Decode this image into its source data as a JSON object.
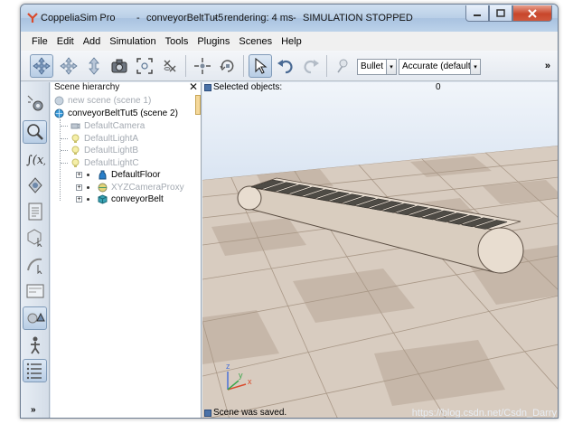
{
  "titlebar": {
    "app_name": "CoppeliaSim Pro",
    "separator": "-",
    "document": "conveyorBeltTut5",
    "rendering": "rendering: 4 ms",
    "state": "SIMULATION STOPPED"
  },
  "menubar": {
    "items": [
      "File",
      "Edit",
      "Add",
      "Simulation",
      "Tools",
      "Plugins",
      "Scenes",
      "Help"
    ]
  },
  "toolbar": {
    "engine_label": "Bullet",
    "accuracy_label": "Accurate (default)",
    "overflow": "»",
    "dropdown_glyph": "▾"
  },
  "left_toolbar": {
    "more": "»"
  },
  "hierarchy": {
    "title": "Scene hierarchy",
    "close": "✕",
    "scene1": "new scene (scene 1)",
    "scene2": "conveyorBeltTut5 (scene 2)",
    "items": [
      {
        "label": "DefaultCamera"
      },
      {
        "label": "DefaultLightA"
      },
      {
        "label": "DefaultLightB"
      },
      {
        "label": "DefaultLightC"
      },
      {
        "label": "DefaultFloor"
      },
      {
        "label": "XYZCameraProxy"
      },
      {
        "label": "conveyorBelt"
      }
    ],
    "expander_glyph": "+"
  },
  "viewport": {
    "selected_label": "Selected objects:",
    "selected_count": "0",
    "status": "Scene was saved.",
    "axis_x": "x",
    "axis_y": "y",
    "axis_z": "z",
    "watermark": "https://blog.csdn.net/Csdn_Darry"
  },
  "colors": {
    "floor_light": "#ddd1c5",
    "floor_dark": "#bba99a",
    "belt_body": "#e8ddd0",
    "belt_pads": "#4e4b45"
  }
}
